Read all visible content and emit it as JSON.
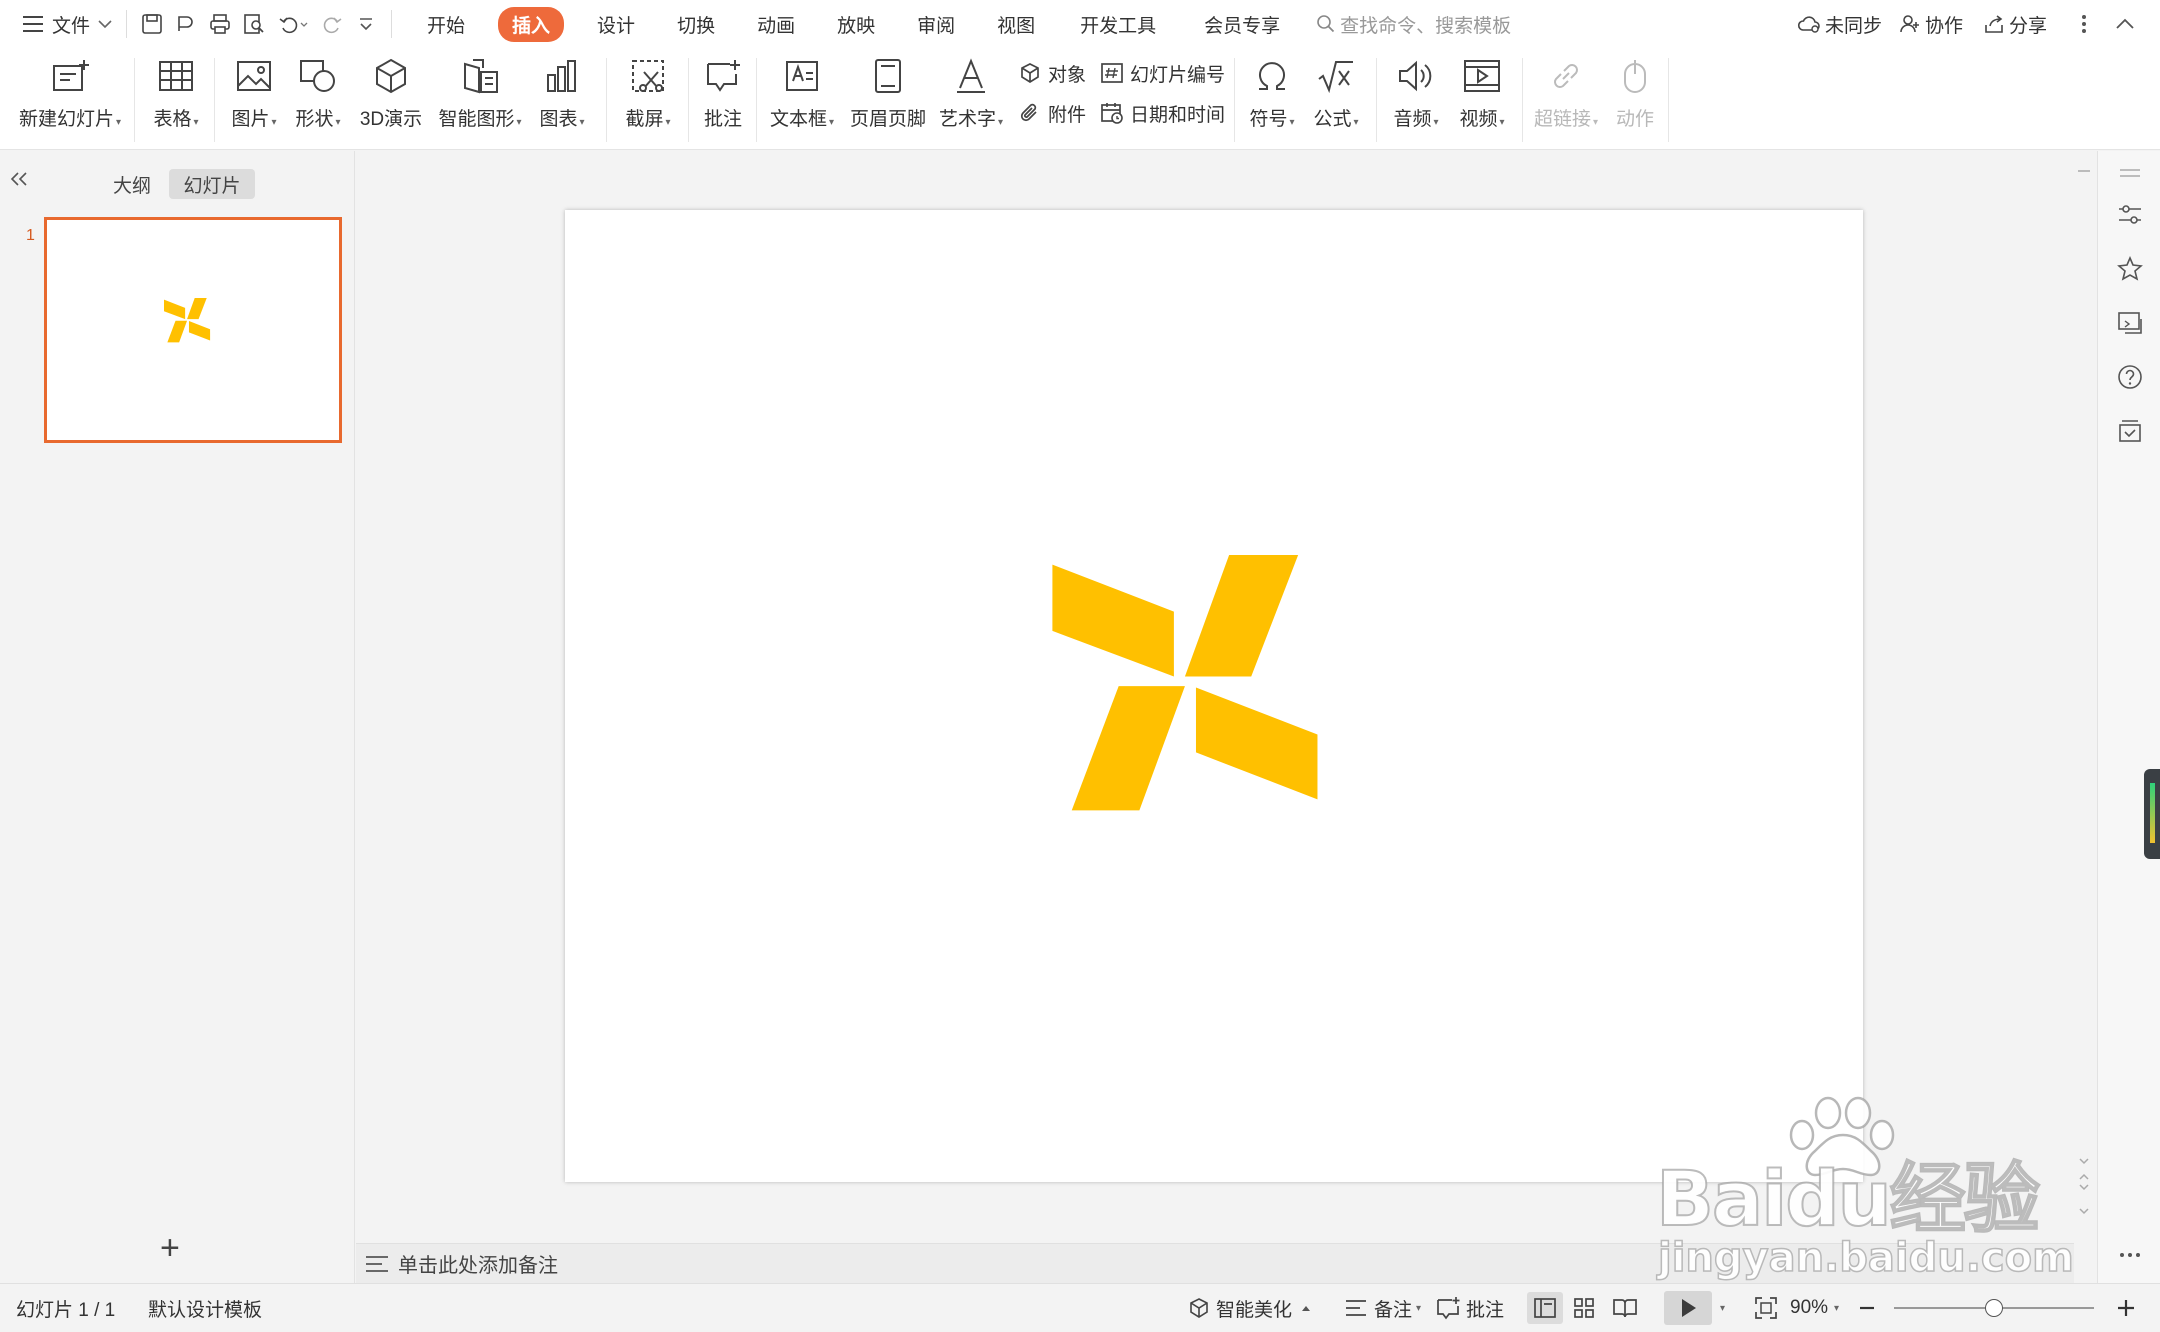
{
  "menubar": {
    "file_label": "文件",
    "tabs": [
      "开始",
      "插入",
      "设计",
      "切换",
      "动画",
      "放映",
      "审阅",
      "视图",
      "开发工具",
      "会员专享"
    ],
    "active_tab": "插入",
    "search_placeholder": "查找命令、搜索模板",
    "sync_label": "未同步",
    "collab_label": "协作",
    "share_label": "分享"
  },
  "ribbon": {
    "new_slide": "新建幻灯片",
    "table": "表格",
    "picture": "图片",
    "shape": "形状",
    "3d": "3D演示",
    "smartart": "智能图形",
    "chart": "图表",
    "screenshot": "截屏",
    "comment": "批注",
    "textbox": "文本框",
    "header_footer": "页眉页脚",
    "wordart": "艺术字",
    "object": "对象",
    "slide_number": "幻灯片编号",
    "attachment": "附件",
    "date_time": "日期和时间",
    "symbol": "符号",
    "formula": "公式",
    "audio": "音频",
    "video": "视频",
    "hyperlink": "超链接",
    "action": "动作"
  },
  "left_pane": {
    "tab_outline": "大纲",
    "tab_slides": "幻灯片",
    "active_tab": "幻灯片",
    "slide_number": "1",
    "add_label": "+"
  },
  "notes": {
    "placeholder": "单击此处添加备注"
  },
  "status": {
    "slide_indicator": "幻灯片 1 / 1",
    "template": "默认设计模板",
    "beautify": "智能美化",
    "notes": "备注",
    "comment": "批注",
    "zoom": "90%",
    "zoom_level": 0.5
  },
  "watermark": {
    "line1": "Baidu经验",
    "line2": "jingyan.baidu.com"
  },
  "colors": {
    "accent": "#ee6a3b",
    "shape_fill": "#ffc000",
    "selection": "#e8692e"
  }
}
